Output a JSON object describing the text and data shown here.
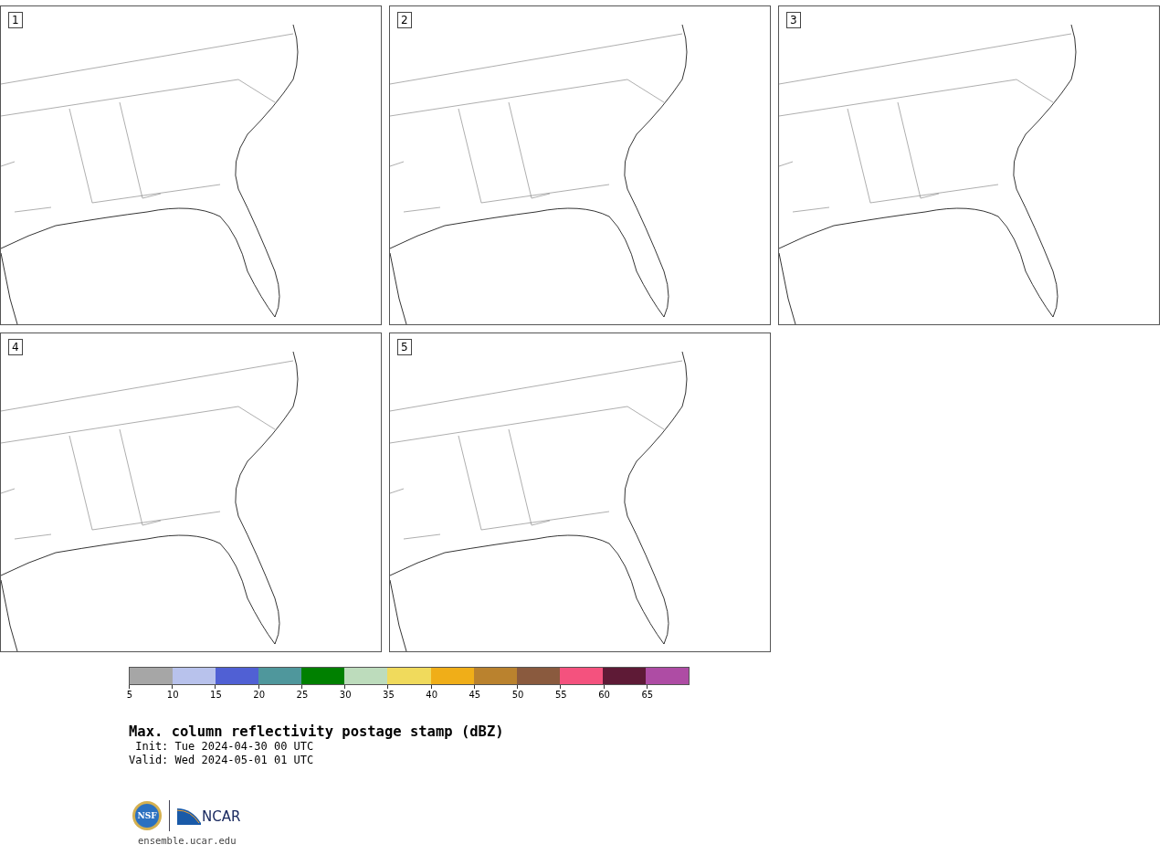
{
  "panels": [
    {
      "label": "1"
    },
    {
      "label": "2"
    },
    {
      "label": "3"
    },
    {
      "label": "4"
    },
    {
      "label": "5"
    }
  ],
  "colorbar": {
    "bins": [
      {
        "tick": "5",
        "color": "#a6a6a6"
      },
      {
        "tick": "10",
        "color": "#b8c2ec"
      },
      {
        "tick": "15",
        "color": "#5060d4"
      },
      {
        "tick": "20",
        "color": "#4f979c"
      },
      {
        "tick": "25",
        "color": "#008000"
      },
      {
        "tick": "30",
        "color": "#bddcbc"
      },
      {
        "tick": "35",
        "color": "#f0da5c"
      },
      {
        "tick": "40",
        "color": "#f0ae18"
      },
      {
        "tick": "45",
        "color": "#ba822e"
      },
      {
        "tick": "50",
        "color": "#8a5a3e"
      },
      {
        "tick": "55",
        "color": "#f4527e"
      },
      {
        "tick": "60",
        "color": "#5e1a36"
      },
      {
        "tick": "65",
        "color": "#ae4ca4"
      }
    ]
  },
  "title": "Max. column reflectivity postage stamp (dBZ)",
  "init": " Init: Tue 2024-04-30 00 UTC",
  "valid": "Valid: Wed 2024-05-01 01 UTC",
  "logos": {
    "nsf": "NSF",
    "ncar": "NCAR"
  },
  "url": "ensemble.ucar.edu"
}
